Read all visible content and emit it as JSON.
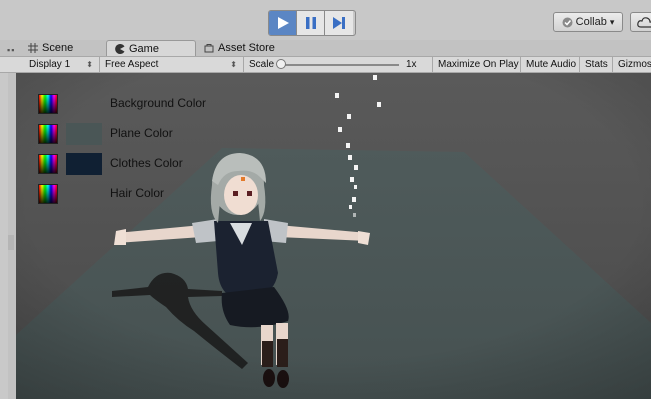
{
  "toolbar": {
    "collab_label": "Collab",
    "collab_arrow": "▾"
  },
  "tabs": [
    {
      "label": "Scene",
      "icon": "hash-grid-icon"
    },
    {
      "label": "Game",
      "icon": "pacman-icon"
    },
    {
      "label": "Asset Store",
      "icon": "store-icon"
    }
  ],
  "game_toolbar": {
    "display": "Display 1",
    "aspect": "Free Aspect",
    "scale_label": "Scale",
    "scale_value": "1x",
    "scale_fraction": 0.0,
    "maximize_on_play": "Maximize On Play",
    "mute_audio": "Mute Audio",
    "stats": "Stats",
    "gizmos": "Gizmos"
  },
  "color_rows": [
    {
      "label": "Background Color",
      "swatch": null
    },
    {
      "label": "Plane Color",
      "swatch": "#4a5656"
    },
    {
      "label": "Clothes Color",
      "swatch": "#102033"
    },
    {
      "label": "Hair Color",
      "swatch": null
    }
  ],
  "colors": {
    "play_active": "#5b86c4",
    "viewport_bg": "#545454",
    "plane": "#4a5656"
  }
}
